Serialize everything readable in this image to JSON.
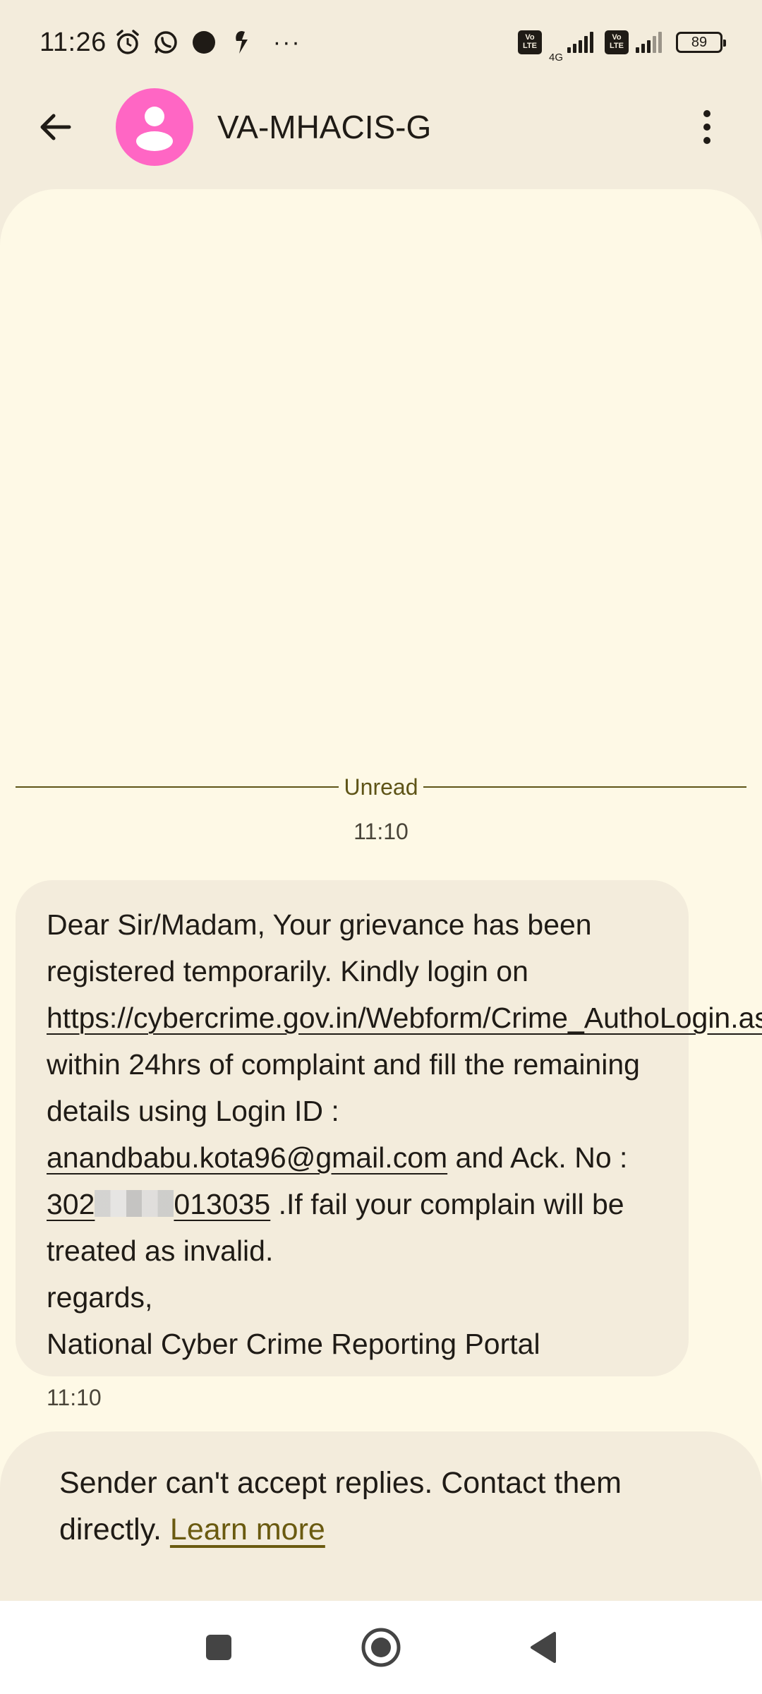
{
  "status_bar": {
    "time": "11:26",
    "icons_left": [
      "alarm-icon",
      "whatsapp-icon",
      "record-dot-icon",
      "notification-icon"
    ],
    "overflow": "···",
    "volte_label_1": "Vo LTE",
    "network_label": "4G",
    "volte_label_2": "Vo LTE",
    "battery": "89"
  },
  "app_bar": {
    "contact_name": "VA-MHACIS-G",
    "avatar_color": "#ff66c4"
  },
  "conversation": {
    "unread_label": "Unread",
    "date_time": "11:10",
    "message": {
      "text_1": "Dear Sir/Madam, Your grievance has been registered temporarily. Kindly login on ",
      "link_url": "https://cybercrime.gov.in/Webform/Crime_AuthoLogin.aspx",
      "text_2": " within 24hrs of complaint and fill the remaining details using Login ID : ",
      "email": "anandbabu.kota96@gmail.com",
      "text_3": " and Ack. No : ",
      "ack_prefix": "302",
      "ack_suffix": "013035",
      "text_4": " .If fail your complain will be treated as invalid.",
      "regards": "regards,",
      "signature": "National Cyber Crime Reporting Portal"
    },
    "message_time": "11:10"
  },
  "reply_notice": {
    "text": "Sender can't accept replies. Contact them directly. ",
    "link": "Learn more"
  },
  "colors": {
    "background": "#f3ecdc",
    "conversation_bg": "#fef9e6",
    "accent": "#5e5417"
  }
}
